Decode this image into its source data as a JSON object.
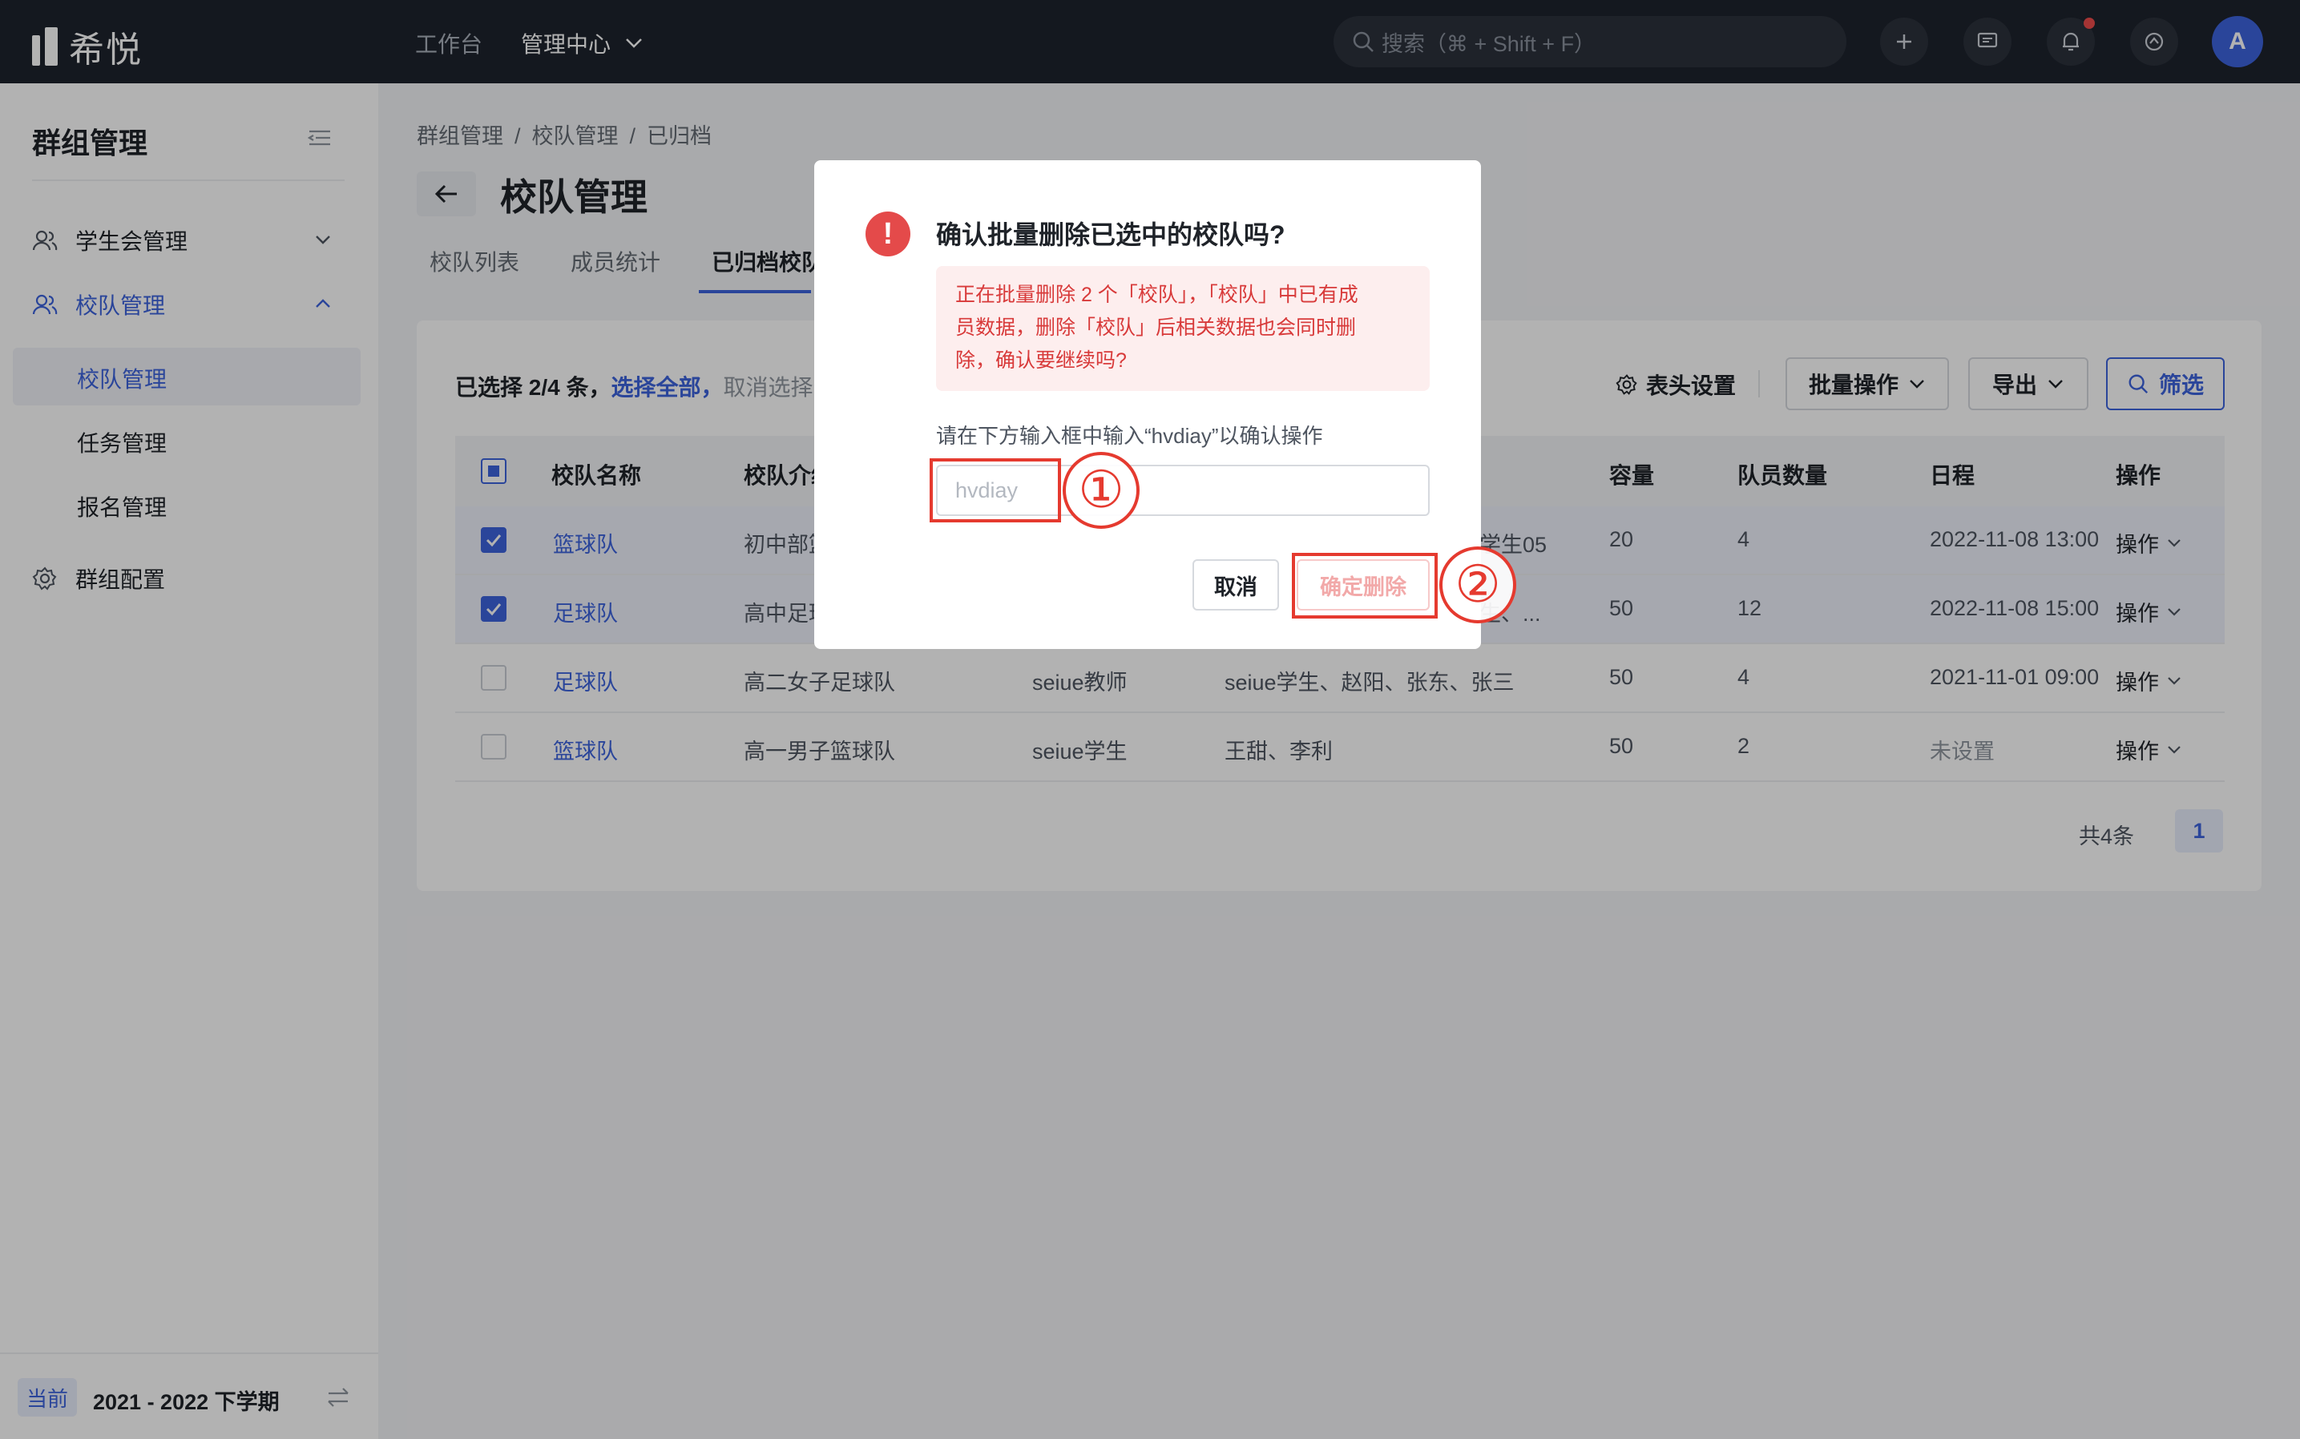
{
  "topbar": {
    "logo_text": "希悦",
    "nav": {
      "workspace": "工作台",
      "admin_center": "管理中心"
    },
    "search_placeholder": "搜索（⌘ + Shift + F）",
    "avatar_letter": "A"
  },
  "sidebar": {
    "title": "群组管理",
    "items": [
      {
        "label": "学生会管理",
        "icon": "users-icon"
      },
      {
        "label": "校队管理",
        "icon": "users-icon"
      },
      {
        "label": "群组配置",
        "icon": "gear-icon"
      }
    ],
    "sub_items": [
      "校队管理",
      "任务管理",
      "报名管理"
    ],
    "term_badge": "当前",
    "term_text": "2021 - 2022 下学期"
  },
  "breadcrumb": [
    "群组管理",
    "校队管理",
    "已归档"
  ],
  "page_title": "校队管理",
  "tabs": [
    "校队列表",
    "成员统计",
    "已归档校队"
  ],
  "toolbar": {
    "selected_prefix": "已选择 2/4 条，",
    "select_all": "选择全部，",
    "cancel_select": "取消选择",
    "header_settings": "表头设置",
    "batch_ops": "批量操作",
    "export": "导出",
    "filter": "筛选"
  },
  "table": {
    "columns": [
      "校队名称",
      "校队介绍",
      "容量",
      "队员数量",
      "日程",
      "操作"
    ],
    "rows": [
      {
        "name": "篮球队",
        "intro": "初中部篮",
        "leader": "",
        "members_partial": "学生05",
        "capacity": "20",
        "count": "4",
        "schedule": "2022-11-08 13:00",
        "op": "操作",
        "selected": true
      },
      {
        "name": "足球队",
        "intro": "高中足球",
        "leader": "",
        "members_partial": "生、...",
        "capacity": "50",
        "count": "12",
        "schedule": "2022-11-08 15:00",
        "op": "操作",
        "selected": true
      },
      {
        "name": "足球队",
        "intro": "高二女子足球队",
        "leader": "seiue教师",
        "members_partial": "seiue学生、赵阳、张东、张三",
        "capacity": "50",
        "count": "4",
        "schedule": "2021-11-01 09:00",
        "op": "操作",
        "selected": false
      },
      {
        "name": "篮球队",
        "intro": "高一男子篮球队",
        "leader": "seiue学生",
        "members_partial": "王甜、李利",
        "capacity": "50",
        "count": "2",
        "schedule": "未设置",
        "op": "操作",
        "selected": false
      }
    ]
  },
  "pagination": {
    "total": "共4条",
    "current_page": "1"
  },
  "modal": {
    "title": "确认批量删除已选中的校队吗?",
    "alert_lines": [
      "正在批量删除 2 个「校队」，「校队」中已有成",
      "员数据，删除「校队」后相关数据也会同时删",
      "除，确认要继续吗?"
    ],
    "confirm_label": "请在下方输入框中输入“hvdiay”以确认操作",
    "input_placeholder": "hvdiay",
    "input_value": "",
    "cancel": "取消",
    "confirm_delete": "确定删除"
  },
  "annotations": {
    "step1": "①",
    "step2": "②"
  },
  "colors": {
    "accent": "#3d63dd",
    "danger": "#e44a4a",
    "annotation": "#e53a2f",
    "topbar": "#1e232d"
  }
}
